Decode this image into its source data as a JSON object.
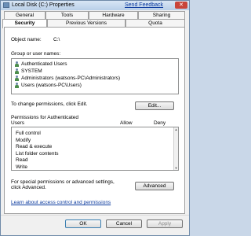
{
  "window": {
    "title": "Local Disk (C:) Properties",
    "feedback_link": "Send Feedback",
    "close_symbol": "✕"
  },
  "tabs": {
    "row1": [
      "General",
      "Tools",
      "Hardware",
      "Sharing"
    ],
    "row2": [
      "Security",
      "Previous Versions",
      "Quota"
    ],
    "active": "Security"
  },
  "security": {
    "object_name_label": "Object name:",
    "object_name_value": "C:\\",
    "group_label": "Group or user names:",
    "groups": [
      "Authenticated Users",
      "SYSTEM",
      "Administrators (watsons-PC\\Administrators)",
      "Users (watsons-PC\\Users)"
    ],
    "change_permissions_text": "To change permissions, click Edit.",
    "edit_button": "Edit...",
    "permissions_label_line1": "Permissions for Authenticated",
    "permissions_label_line2": "Users",
    "allow_header": "Allow",
    "deny_header": "Deny",
    "permissions": [
      "Full control",
      "Modify",
      "Read & execute",
      "List folder contents",
      "Read",
      "Write"
    ],
    "special_text_line1": "For special permissions or advanced settings,",
    "special_text_line2": "click Advanced.",
    "advanced_button": "Advanced",
    "learn_link": "Learn about access control and permissions"
  },
  "footer": {
    "ok": "OK",
    "cancel": "Cancel",
    "apply": "Apply"
  },
  "icons": {
    "user_icon": "user-group-icon",
    "app_icon": "drive-icon"
  }
}
